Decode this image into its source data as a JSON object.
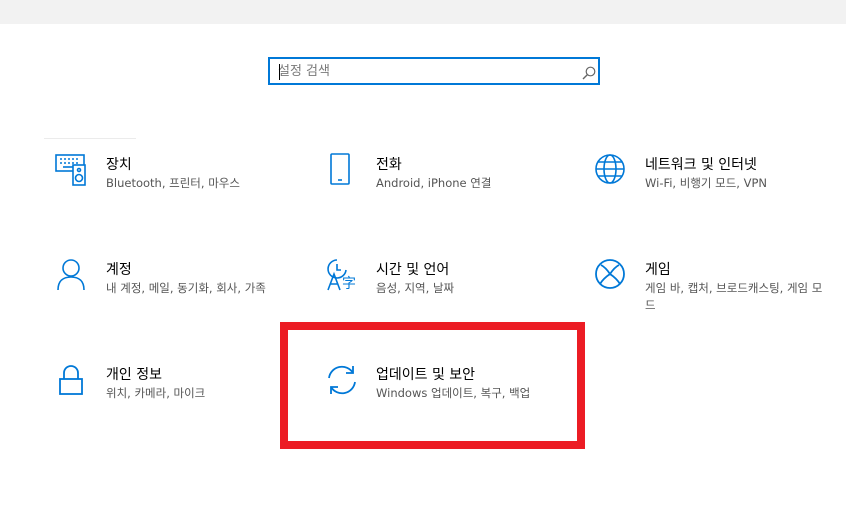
{
  "search": {
    "placeholder": "설정 검색",
    "value": ""
  },
  "colors": {
    "accent": "#0078d7",
    "highlight": "#ec1c24"
  },
  "tiles": [
    {
      "icon": "keyboard-speaker-icon",
      "title": "장치",
      "desc": "Bluetooth, 프린터, 마우스"
    },
    {
      "icon": "phone-icon",
      "title": "전화",
      "desc": "Android, iPhone 연결"
    },
    {
      "icon": "globe-icon",
      "title": "네트워크 및 인터넷",
      "desc": "Wi-Fi, 비행기 모드, VPN"
    },
    {
      "icon": "person-icon",
      "title": "계정",
      "desc": "내 계정, 메일, 동기화, 회사, 가족"
    },
    {
      "icon": "language-time-icon",
      "title": "시간 및 언어",
      "desc": "음성, 지역, 날짜"
    },
    {
      "icon": "xbox-icon",
      "title": "게임",
      "desc": "게임 바, 캡처, 브로드캐스팅, 게임 모드"
    },
    {
      "icon": "lock-icon",
      "title": "개인 정보",
      "desc": "위치, 카메라, 마이크"
    },
    {
      "icon": "sync-icon",
      "title": "업데이트 및 보안",
      "desc": "Windows 업데이트, 복구, 백업"
    }
  ]
}
